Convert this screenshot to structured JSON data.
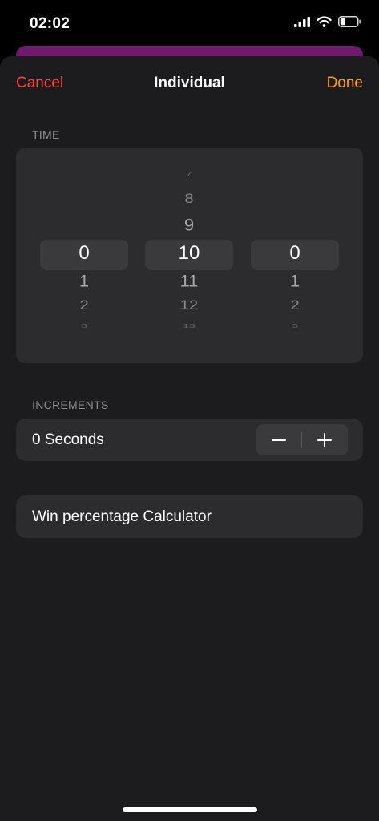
{
  "status_bar": {
    "time": "02:02",
    "battery_level": 0.3
  },
  "header": {
    "cancel_label": "Cancel",
    "title": "Individual",
    "done_label": "Done"
  },
  "time_section": {
    "header": "TIME",
    "pickers": [
      {
        "name": "first",
        "items": [
          "",
          "",
          "",
          "0",
          "1",
          "2",
          "3"
        ]
      },
      {
        "name": "second",
        "items": [
          "7",
          "8",
          "9",
          "10",
          "11",
          "12",
          "13"
        ]
      },
      {
        "name": "third",
        "items": [
          "",
          "",
          "",
          "0",
          "1",
          "2",
          "3"
        ]
      }
    ]
  },
  "increments": {
    "header": "INCREMENTS",
    "value_label": "0 Seconds",
    "minus_symbol": "−",
    "plus_symbol": "+"
  },
  "calculator": {
    "label": "Win percentage Calculator"
  },
  "colors": {
    "cancel": "#ff453a",
    "done": "#ff9f0a",
    "sheet_background": "#1c1c1e",
    "card_background": "#2c2c2e",
    "purple_strip": "#6f1a6a"
  }
}
